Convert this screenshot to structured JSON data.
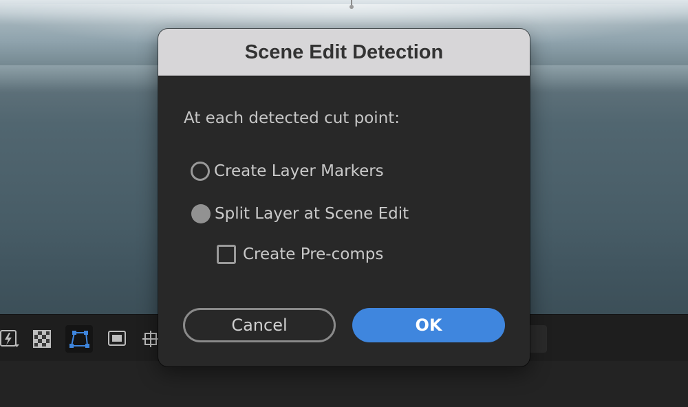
{
  "dialog": {
    "title": "Scene Edit Detection",
    "prompt": "At each detected cut point:",
    "options": [
      {
        "label": "Create Layer Markers",
        "type": "radio",
        "selected": false
      },
      {
        "label": "Split Layer at Scene Edit",
        "type": "radio",
        "selected": true
      },
      {
        "label": "Create Pre-comps",
        "type": "checkbox",
        "checked": false
      }
    ],
    "cancel_label": "Cancel",
    "ok_label": "OK"
  },
  "toolbar": {
    "icons": [
      "fast-preview-icon",
      "transparency-grid-icon",
      "mask-path-icon",
      "region-of-interest-icon",
      "guides-icon"
    ]
  },
  "colors": {
    "accent": "#3f86de",
    "dialog_bg": "#282828",
    "titlebar_bg": "#d7d6d8"
  }
}
